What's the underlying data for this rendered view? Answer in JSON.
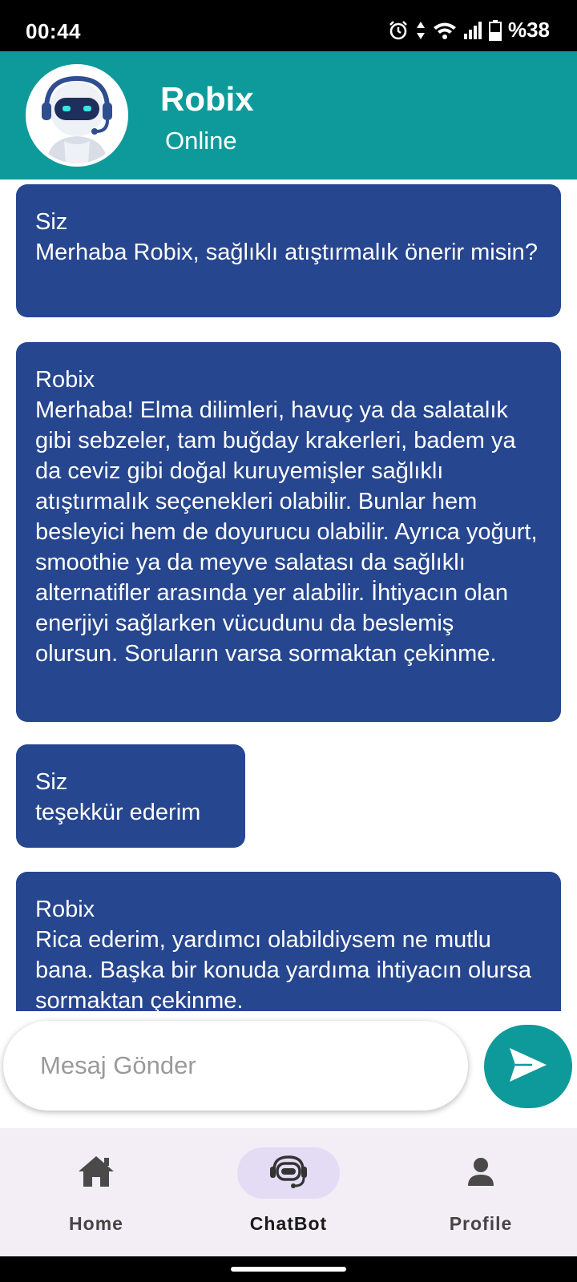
{
  "status_bar": {
    "time": "00:44",
    "battery": "%38",
    "icons": [
      "alarm-icon",
      "data-arrows-icon",
      "wifi-icon",
      "signal-icon",
      "battery-icon"
    ]
  },
  "header": {
    "title": "Robix",
    "status": "Online",
    "avatar": "robot-avatar-icon"
  },
  "messages": [
    {
      "sender": "Siz",
      "text": "Merhaba Robix, sağlıklı atıştırmalık önerir misin?"
    },
    {
      "sender": "Robix",
      "text": "Merhaba! Elma dilimleri, havuç ya da salatalık gibi sebzeler, tam buğday krakerleri, badem ya da ceviz gibi doğal kuruyemişler sağlıklı atıştırmalık seçenekleri olabilir. Bunlar hem besleyici hem de doyurucu olabilir. Ayrıca yoğurt, smoothie ya da meyve salatası da sağlıklı alternatifler arasında yer alabilir. İhtiyacın olan enerjiyi sağlarken vücudunu da beslemiş olursun.  Soruların varsa sormaktan çekinme."
    },
    {
      "sender": "Siz",
      "text": "teşekkür ederim"
    },
    {
      "sender": "Robix",
      "text": "Rica ederim, yardımcı olabildiysem ne mutlu bana. Başka bir konuda yardıma ihtiyacın olursa sormaktan çekinme."
    }
  ],
  "input": {
    "placeholder": "Mesaj Gönder",
    "value": ""
  },
  "bottom_nav": {
    "items": [
      {
        "label": "Home",
        "icon": "home-icon",
        "active": false
      },
      {
        "label": "ChatBot",
        "icon": "robot-icon",
        "active": true
      },
      {
        "label": "Profile",
        "icon": "person-icon",
        "active": false
      }
    ]
  },
  "colors": {
    "teal": "#0e9a9a",
    "bubble": "#26468f",
    "nav_bg": "#f3eef6",
    "nav_active": "#e4dcf4"
  }
}
